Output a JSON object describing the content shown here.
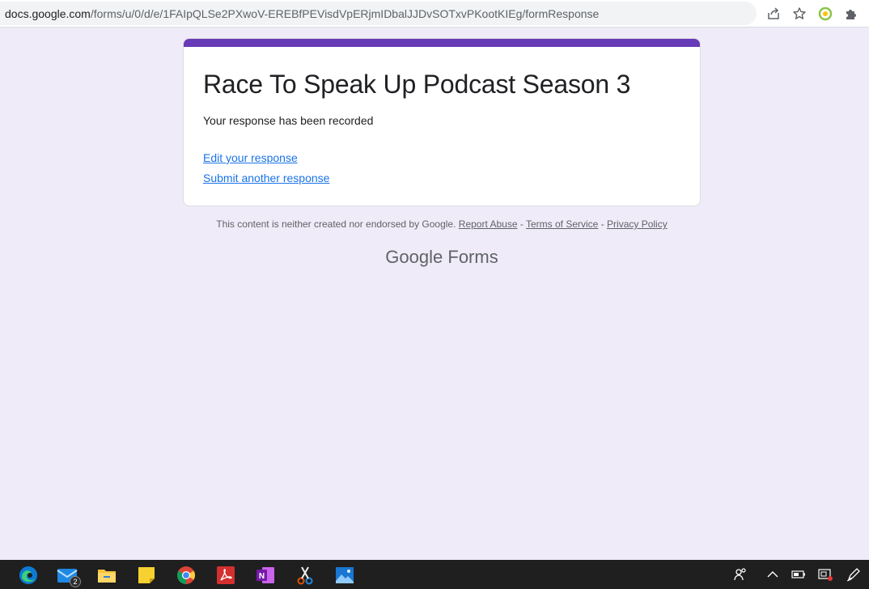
{
  "browser": {
    "url_host": "docs.google.com",
    "url_path": "/forms/u/0/d/e/1FAIpQLSe2PXwoV-EREBfPEVisdVpERjmIDbalJJDvSOTxvPKootKIEg/formResponse",
    "icons": [
      "share-icon",
      "star-icon",
      "extension-circle-icon",
      "puzzle-extensions-icon"
    ]
  },
  "form": {
    "title": "Race To Speak Up Podcast Season 3",
    "confirmation": "Your response has been recorded",
    "edit_link": "Edit your response",
    "another_link": "Submit another response",
    "accent_color": "#673ab7"
  },
  "footer": {
    "disclaimer": "This content is neither created nor endorsed by Google.",
    "report_abuse": "Report Abuse",
    "terms": "Terms of Service",
    "privacy": "Privacy Policy",
    "separator": "-",
    "brand_google": "Google",
    "brand_forms": "Forms"
  },
  "taskbar": {
    "apps": [
      "edge-icon",
      "mail-icon",
      "file-explorer-icon",
      "sticky-notes-icon",
      "chrome-icon",
      "acrobat-icon",
      "onenote-icon",
      "snipping-tool-icon",
      "photos-icon"
    ],
    "mail_badge": "2",
    "tray": [
      "people-icon",
      "chevron-up-icon",
      "battery-icon",
      "action-center-icon",
      "pen-icon"
    ]
  }
}
